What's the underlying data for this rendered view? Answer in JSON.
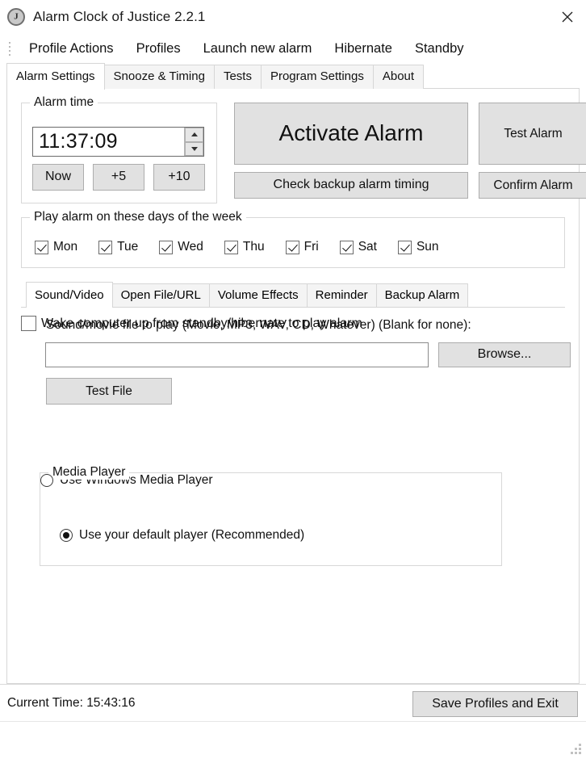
{
  "window": {
    "title": "Alarm Clock of Justice 2.2.1",
    "app_icon": "clock-j-icon",
    "close_label": "✕"
  },
  "menubar": {
    "grip": "drag-grip",
    "items": [
      {
        "label": "Profile Actions"
      },
      {
        "label": "Profiles"
      },
      {
        "label": "Launch new alarm"
      },
      {
        "label": "Hibernate"
      },
      {
        "label": "Standby"
      }
    ]
  },
  "tabs": {
    "active": "Alarm Settings",
    "items": [
      {
        "label": "Alarm Settings",
        "active": true
      },
      {
        "label": "Snooze & Timing",
        "active": false
      },
      {
        "label": "Tests",
        "active": false
      },
      {
        "label": "Program Settings",
        "active": false
      },
      {
        "label": "About",
        "active": false
      }
    ]
  },
  "alarm_time": {
    "group_title": "Alarm time",
    "value": "11:37:09",
    "spinner_up": "spinner-up",
    "spinner_down": "spinner-down",
    "quick_buttons": [
      {
        "label": "Now"
      },
      {
        "label": "+5"
      },
      {
        "label": "+10"
      }
    ]
  },
  "actions": {
    "activate": "Activate Alarm",
    "test_alarm": "Test Alarm",
    "check_backup": "Check backup alarm timing",
    "confirm_alarm": "Confirm Alarm"
  },
  "days": {
    "group_title": "Play alarm on these days of the week",
    "items": [
      {
        "label": "Mon",
        "checked": true
      },
      {
        "label": "Tue",
        "checked": true
      },
      {
        "label": "Wed",
        "checked": true
      },
      {
        "label": "Thu",
        "checked": true
      },
      {
        "label": "Fri",
        "checked": true
      },
      {
        "label": "Sat",
        "checked": true
      },
      {
        "label": "Sun",
        "checked": true
      }
    ]
  },
  "inner_tabs": {
    "active": "Sound/Video",
    "items": [
      {
        "label": "Sound/Video",
        "active": true
      },
      {
        "label": "Open File/URL",
        "active": false
      },
      {
        "label": "Volume Effects",
        "active": false
      },
      {
        "label": "Reminder",
        "active": false
      },
      {
        "label": "Backup Alarm",
        "active": false
      }
    ]
  },
  "sound_video": {
    "lead_label": "Sound/movie file to play (Movie, MP3, WAV, CD, Whatever) (Blank for none):",
    "file_value": "",
    "file_placeholder": "",
    "browse_label": "Browse...",
    "test_file_label": "Test File",
    "media_player": {
      "group_title": "Media Player",
      "options": [
        {
          "label": "Use your default player (Recommended)",
          "selected": true
        },
        {
          "label": "Use Windows Media Player",
          "selected": false
        }
      ]
    }
  },
  "wake": {
    "label": "Wake computer up from standby/hibernate to play alarm",
    "checked": false
  },
  "statusbar": {
    "current_time": "Current Time: 15:43:16",
    "save_label": "Save Profiles and Exit",
    "resize_grip": "resize-grip"
  },
  "colors": {
    "window_bg": "#ffffff",
    "button_face": "#e1e1e1",
    "button_border": "#adadad",
    "border": "#d6d6d6",
    "text": "#111111",
    "tab_inactive": "#f4f4f4"
  }
}
